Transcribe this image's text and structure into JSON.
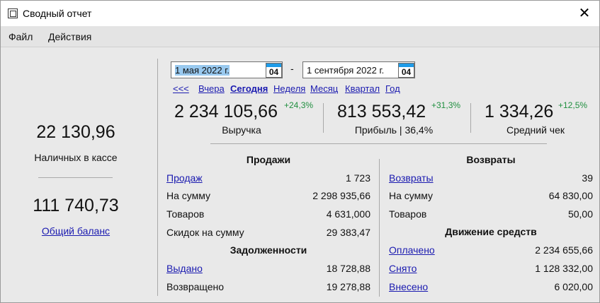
{
  "window": {
    "title": "Сводный отчет",
    "close_label": "✕"
  },
  "menu": {
    "file": "Файл",
    "actions": "Действия"
  },
  "left": {
    "cash_value": "22 130,96",
    "cash_label": "Наличных в кассе",
    "balance_value": "111 740,73",
    "balance_label": "Общий баланс"
  },
  "dates": {
    "from": "1 мая 2022 г.",
    "to": "1 сентября 2022 г.",
    "from_cal_day": "04",
    "to_cal_day": "04",
    "separator": "-"
  },
  "periods": [
    "<<<",
    "Вчера",
    "Сегодня",
    "Неделя",
    "Месяц",
    "Квартал",
    "Год"
  ],
  "active_period": "Сегодня",
  "kpis": [
    {
      "value": "2 234 105,66",
      "delta": "+24,3%",
      "label": "Выручка"
    },
    {
      "value": "813 553,42",
      "delta": "+31,3%",
      "label": "Прибыль | 36,4%"
    },
    {
      "value": "1 334,26",
      "delta": "+12,5%",
      "label": "Средний чек"
    }
  ],
  "sales": {
    "title": "Продажи",
    "rows": [
      {
        "label": "Продаж",
        "value": "1 723"
      },
      {
        "label": "На сумму",
        "value": "2 298 935,66"
      },
      {
        "label": "Товаров",
        "value": "4 631,000"
      },
      {
        "label": "Скидок на сумму",
        "value": "29 383,47"
      }
    ]
  },
  "debts": {
    "title": "Задолженности",
    "rows": [
      {
        "label": "Выдано",
        "value": "18 728,88"
      },
      {
        "label": "Возвращено",
        "value": "19 278,88"
      }
    ]
  },
  "returns": {
    "title": "Возвраты",
    "rows": [
      {
        "label": "Возвраты",
        "value": "39"
      },
      {
        "label": "На сумму",
        "value": "64 830,00"
      },
      {
        "label": "Товаров",
        "value": "50,00"
      }
    ]
  },
  "cashflow": {
    "title": "Движение средств",
    "rows": [
      {
        "label": "Оплачено",
        "value": "2 234 655,66"
      },
      {
        "label": "Снято",
        "value": "1 128 332,00"
      },
      {
        "label": "Внесено",
        "value": "6 020,00"
      }
    ]
  },
  "colors": {
    "link": "#1a1ab0",
    "delta_positive": "#1f8f3f",
    "selection": "#99c9ef",
    "calendar_accent": "#1e9be8"
  }
}
